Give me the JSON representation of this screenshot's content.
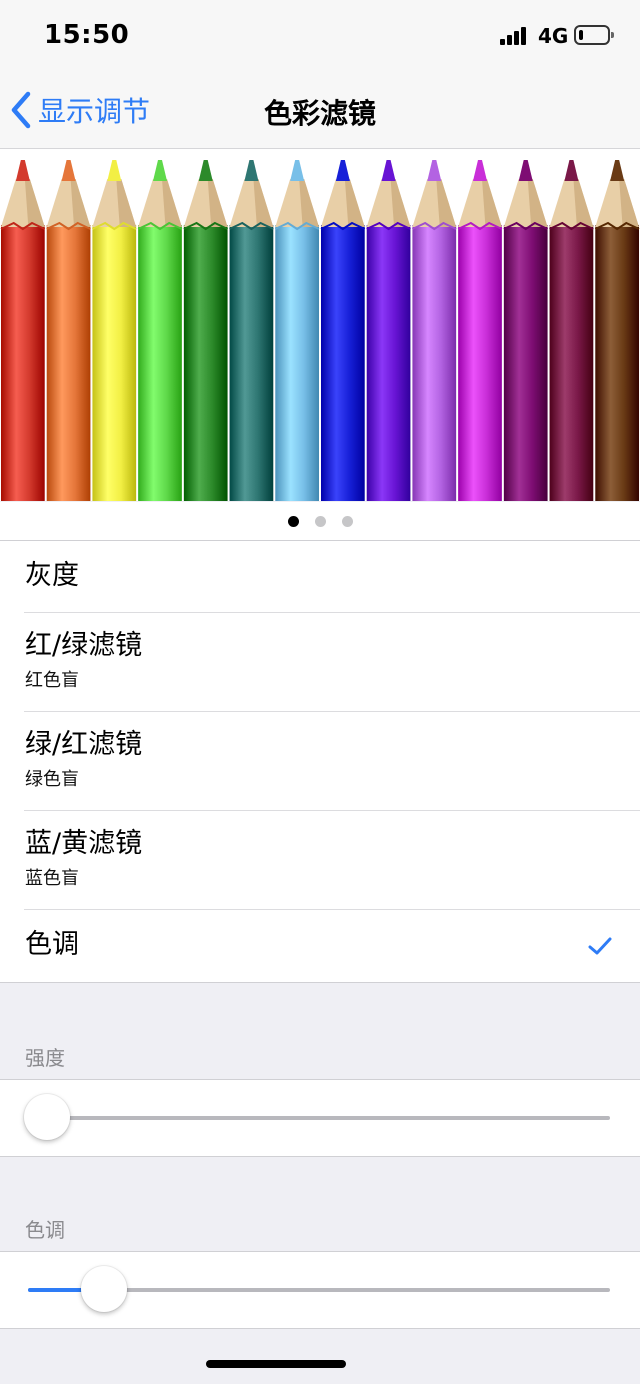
{
  "status_bar": {
    "time": "15:50",
    "network": "4G",
    "signal_bars": 4,
    "battery_level": 0.15
  },
  "nav": {
    "back_label": "显示调节",
    "title": "色彩滤镜"
  },
  "preview": {
    "page_count": 3,
    "current_page": 1,
    "pencil_colors": [
      "#d33a2d",
      "#e5763a",
      "#f2ef44",
      "#5fd94a",
      "#2c8a2a",
      "#2e7672",
      "#78bfe8",
      "#1720d8",
      "#6814d4",
      "#b363e2",
      "#c92ed8",
      "#7e0d73",
      "#7a1848",
      "#6a3b15"
    ]
  },
  "filters": [
    {
      "title": "灰度",
      "subtitle": "",
      "selected": false
    },
    {
      "title": "红/绿滤镜",
      "subtitle": "红色盲",
      "selected": false
    },
    {
      "title": "绿/红滤镜",
      "subtitle": "绿色盲",
      "selected": false
    },
    {
      "title": "蓝/黄滤镜",
      "subtitle": "蓝色盲",
      "selected": false
    },
    {
      "title": "色调",
      "subtitle": "",
      "selected": true
    }
  ],
  "intensity": {
    "label": "强度",
    "value": 0
  },
  "hue": {
    "label": "色调",
    "value": 0.13
  },
  "colors": {
    "accent": "#2e7cf6",
    "background": "#efeff4",
    "cell": "#ffffff"
  }
}
